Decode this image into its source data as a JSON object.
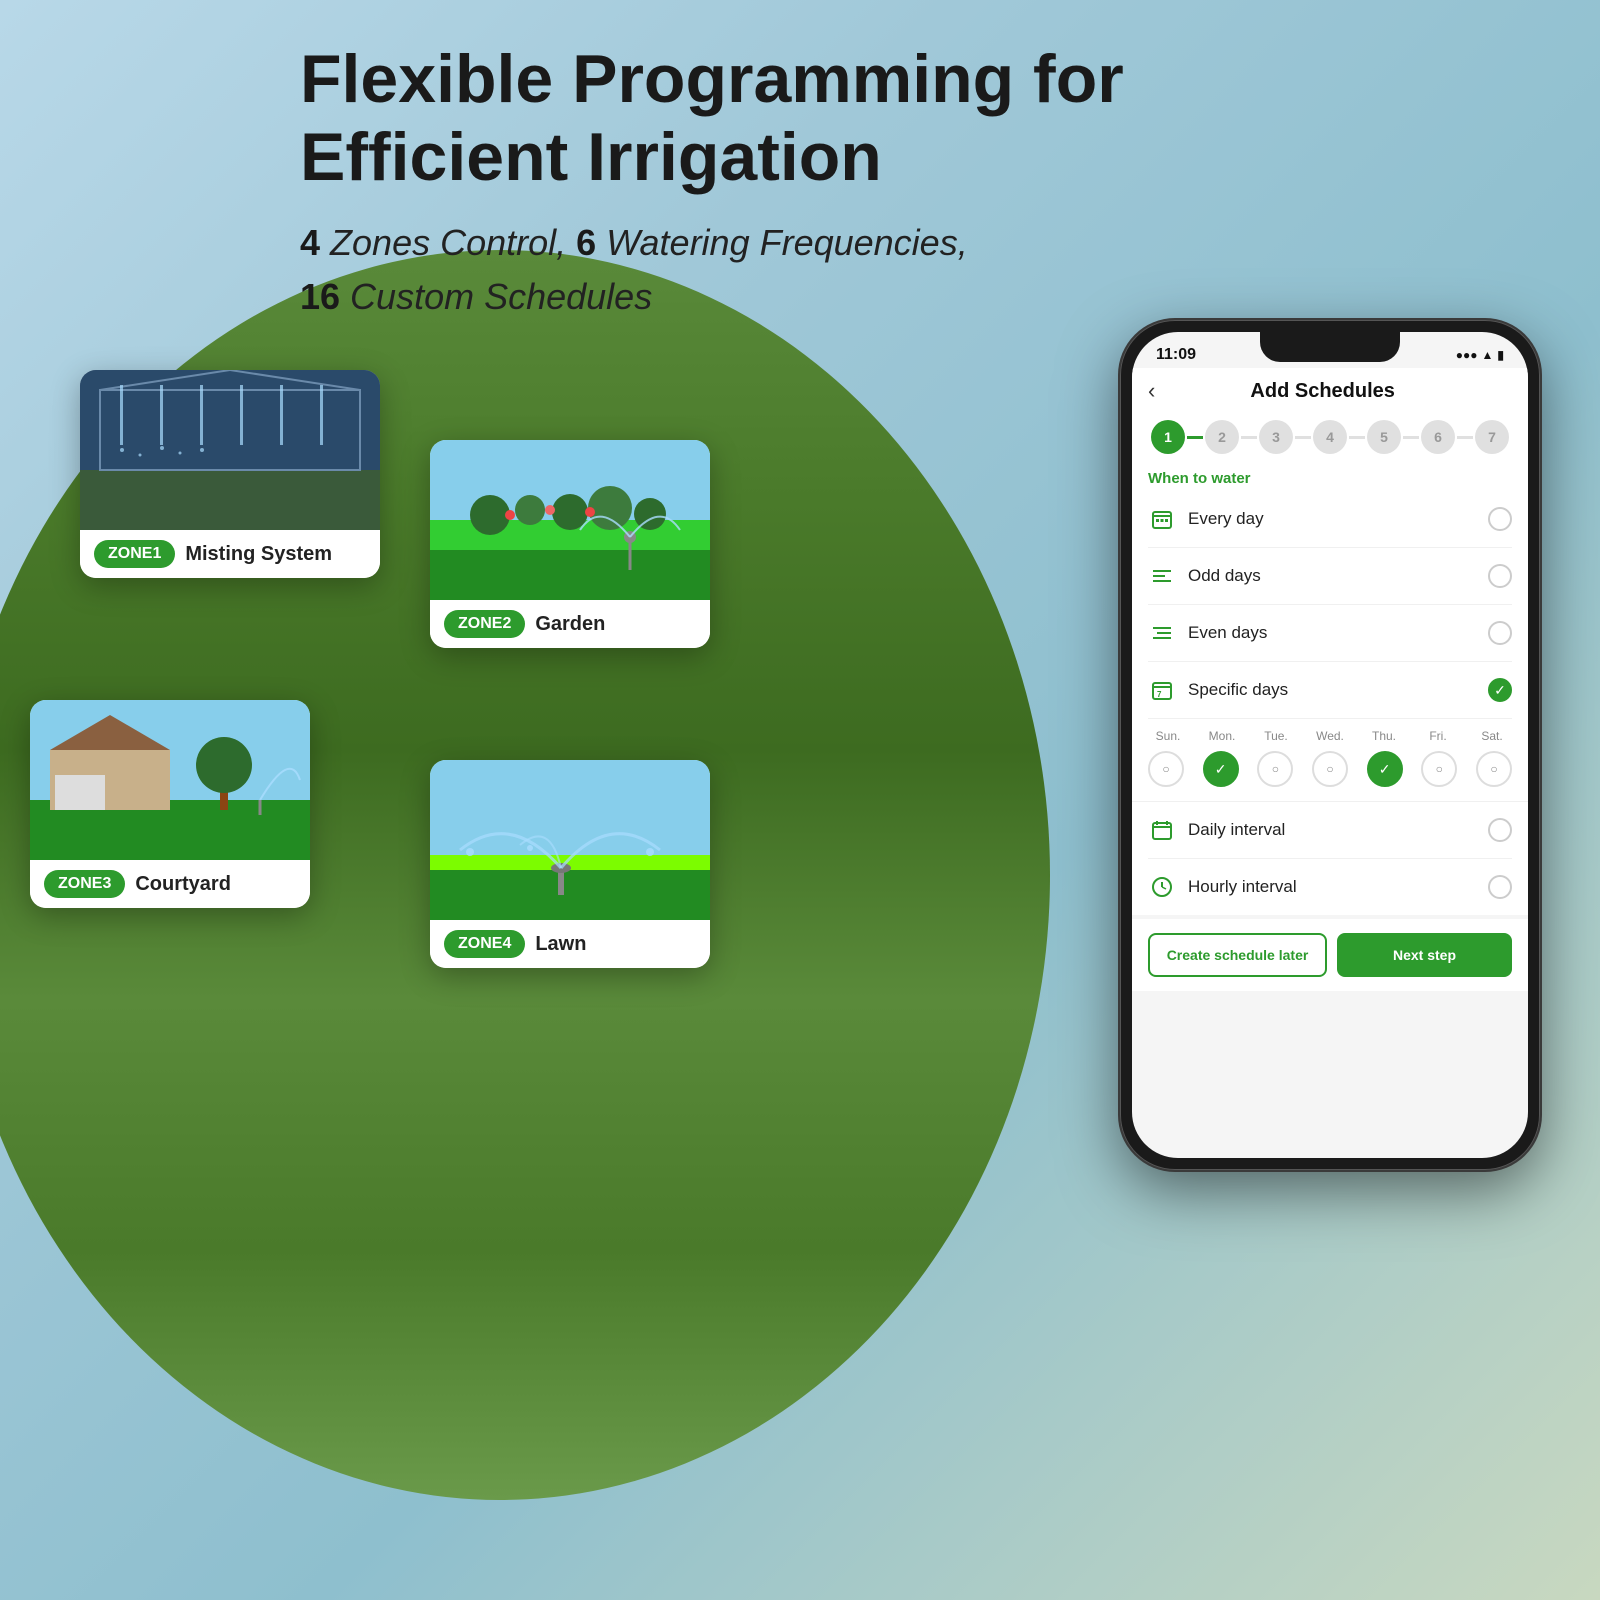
{
  "header": {
    "title_line1": "Flexible Programming for",
    "title_line2": "Efficient Irrigation",
    "subtitle_part1": "4",
    "subtitle_text1": " Zones Control, ",
    "subtitle_part2": "6",
    "subtitle_text2": " Watering Frequencies,",
    "subtitle_part3": "16",
    "subtitle_text3": " Custom Schedules"
  },
  "zones": [
    {
      "id": "ZONE1",
      "name": "Misting System"
    },
    {
      "id": "ZONE2",
      "name": "Garden"
    },
    {
      "id": "ZONE3",
      "name": "Courtyard"
    },
    {
      "id": "ZONE4",
      "name": "Lawn"
    }
  ],
  "phone": {
    "status_time": "11:09",
    "nav_title": "Add Schedules",
    "back_label": "‹",
    "steps": [
      "1",
      "2",
      "3",
      "4",
      "5",
      "6",
      "7"
    ],
    "section_label": "When to water",
    "schedule_options": [
      {
        "icon": "📅",
        "label": "Every day",
        "selected": false
      },
      {
        "icon": "≡",
        "label": "Odd days",
        "selected": false
      },
      {
        "icon": "≡",
        "label": "Even days",
        "selected": false
      },
      {
        "icon": "🗓",
        "label": "Specific days",
        "selected": true
      },
      {
        "icon": "📆",
        "label": "Daily interval",
        "selected": false
      },
      {
        "icon": "🕐",
        "label": "Hourly interval",
        "selected": false
      }
    ],
    "days": {
      "labels": [
        "Sun.",
        "Mon.",
        "Tue.",
        "Wed.",
        "Thu.",
        "Fri.",
        "Sat."
      ],
      "selected": [
        false,
        true,
        false,
        false,
        true,
        false,
        false
      ]
    },
    "btn_later": "Create schedule later",
    "btn_next": "Next step"
  }
}
